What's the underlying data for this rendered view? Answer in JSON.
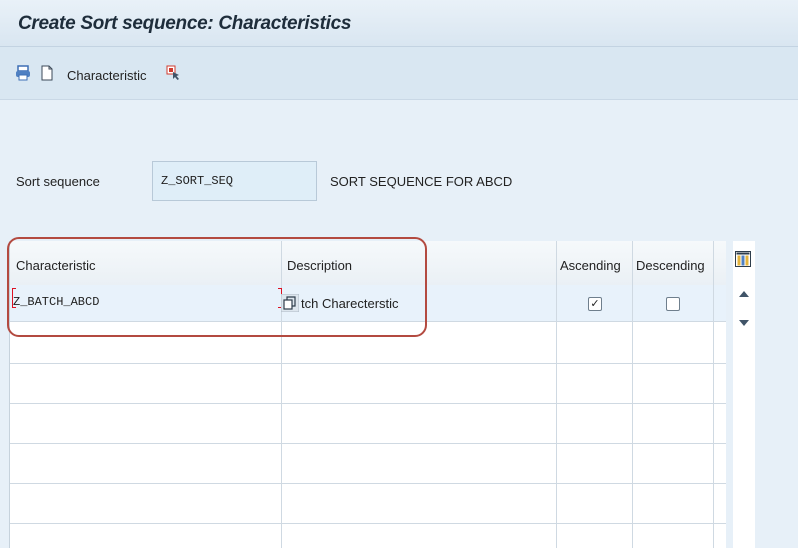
{
  "window": {
    "title": "Create Sort sequence: Characteristics"
  },
  "toolbar": {
    "label": "Characteristic",
    "icons": [
      "print-icon",
      "new-document-icon",
      "pointer-selection-icon"
    ]
  },
  "form": {
    "sort_sequence_label": "Sort sequence",
    "sort_sequence_value": "Z_SORT_SEQ",
    "sort_sequence_description": "SORT SEQUENCE FOR ABCD"
  },
  "table": {
    "headers": {
      "characteristic": "Characteristic",
      "description": "Description",
      "ascending": "Ascending",
      "descending": "Descending"
    },
    "rows": [
      {
        "characteristic": "Z_BATCH_ABCD",
        "description": "tch Charecterstic",
        "ascending": true,
        "descending": false
      }
    ]
  },
  "colors": {
    "title_bar": "#e3edf6",
    "toolbar": "#d9e7f2",
    "selection_outline": "#b34a40",
    "grid_lines": "#cfd9e2"
  }
}
